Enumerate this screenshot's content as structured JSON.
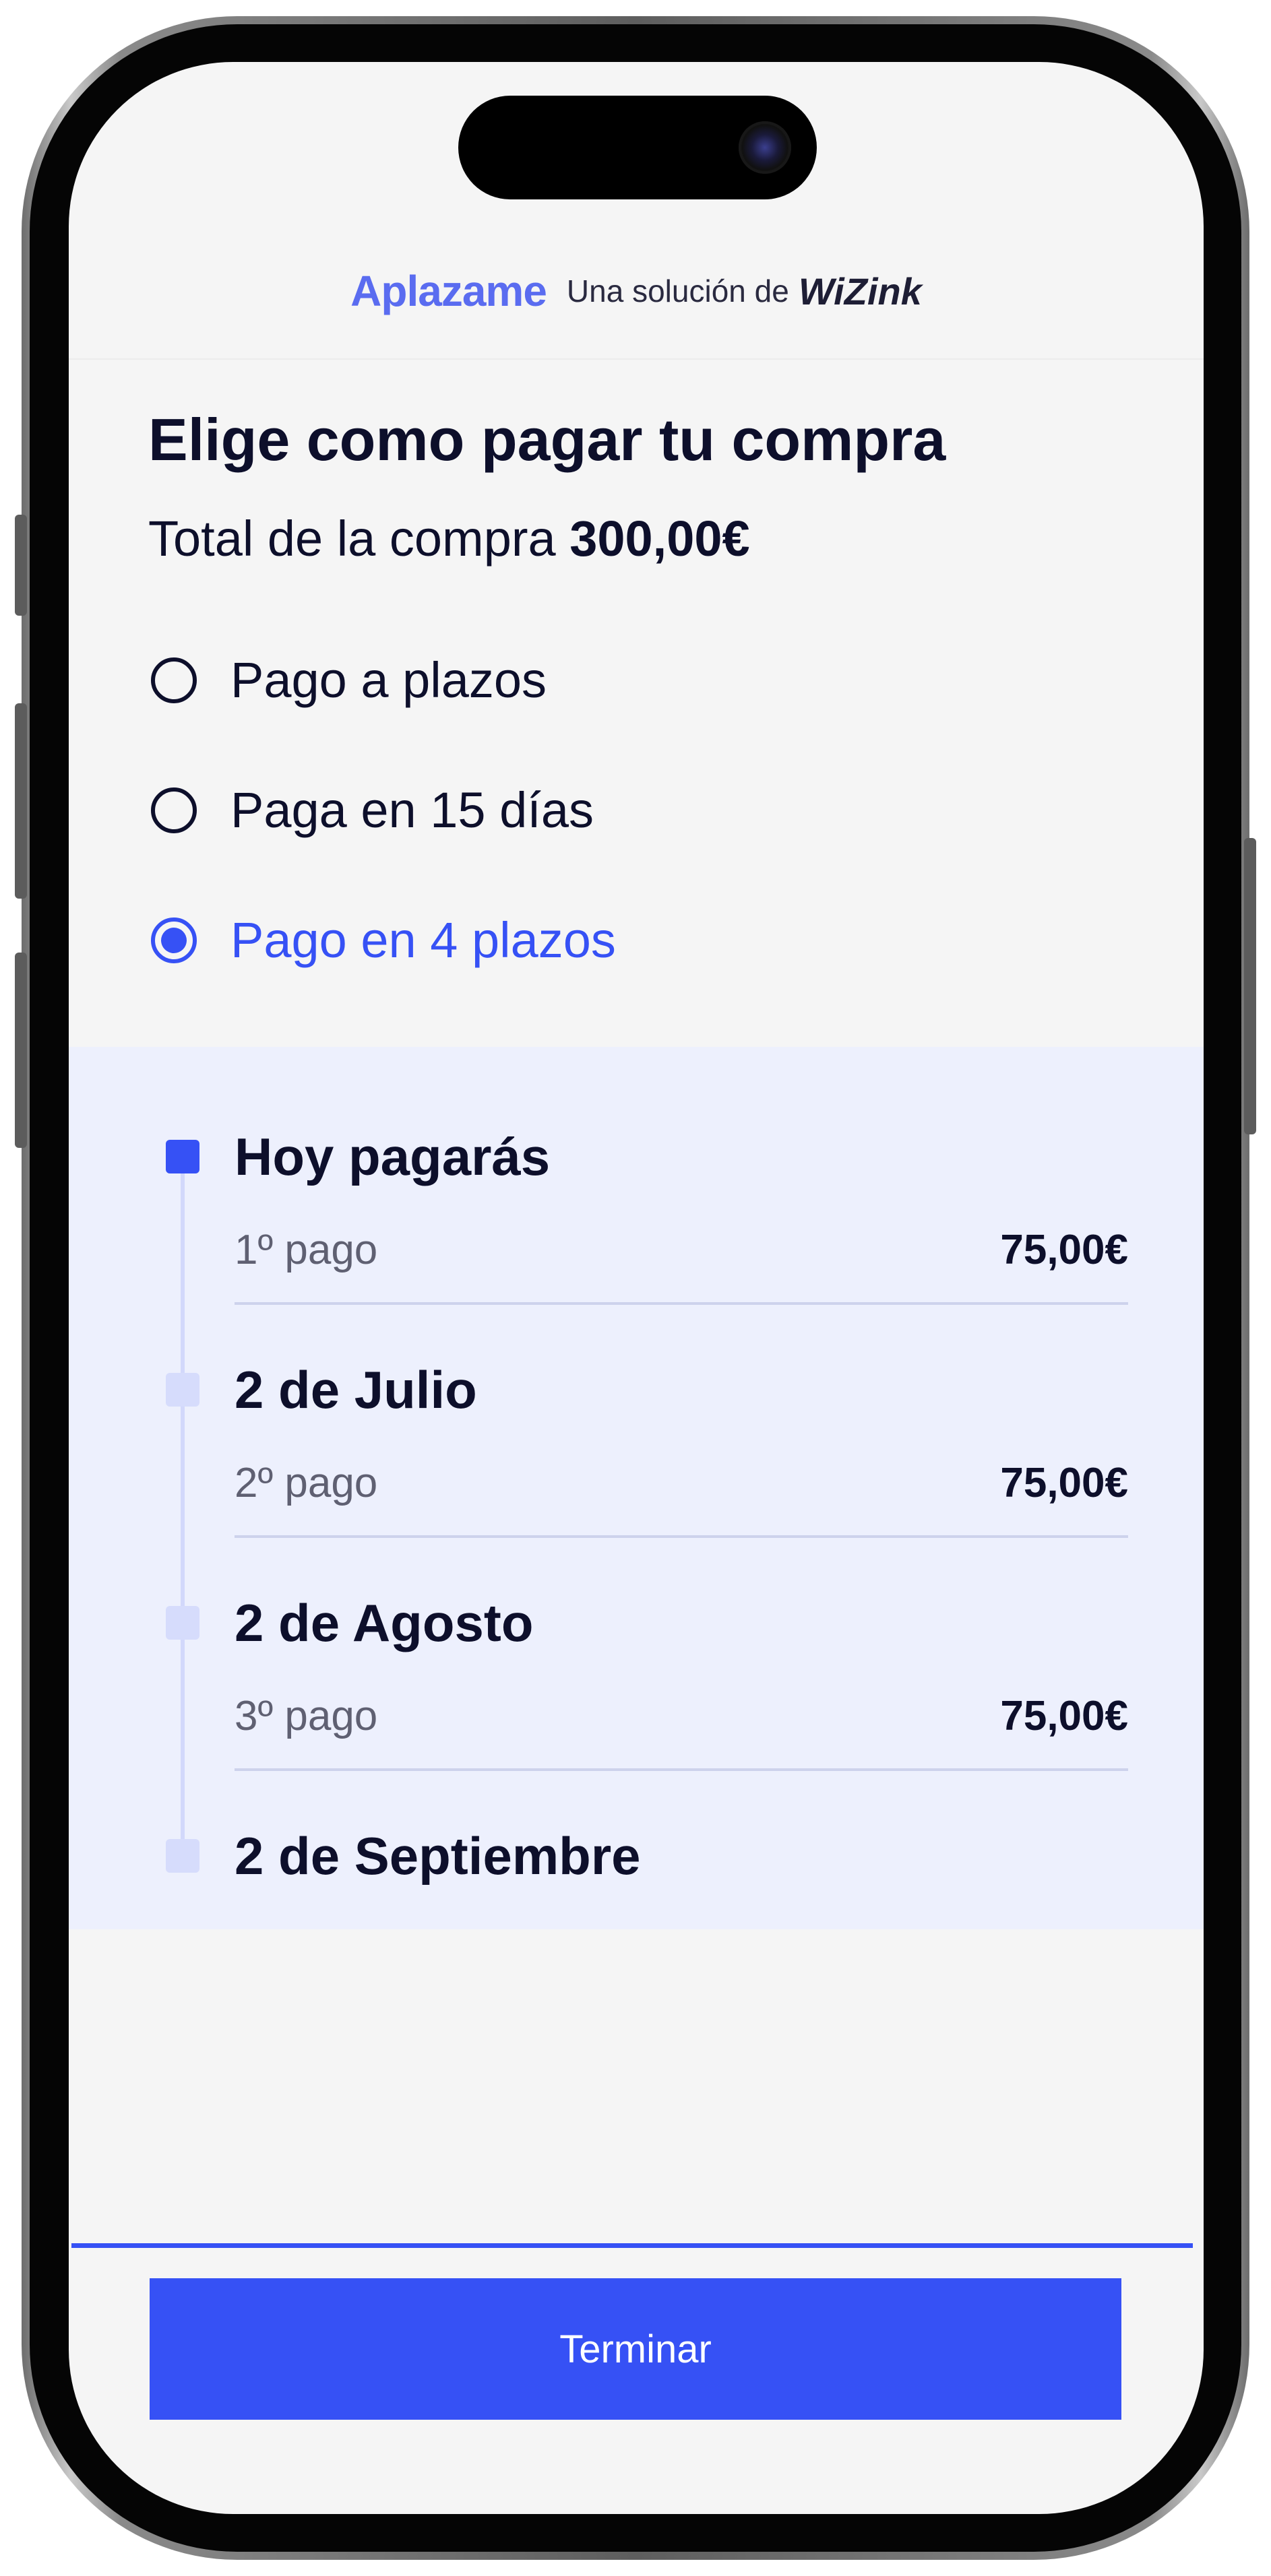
{
  "brand": {
    "logo": "Aplazame",
    "tagline": "Una solución de",
    "partner": "WiZink"
  },
  "checkout": {
    "title": "Elige como pagar tu compra",
    "total_label": "Total de la compra",
    "total_value": "300,00€"
  },
  "payment_options": [
    {
      "label": "Pago a plazos",
      "selected": false
    },
    {
      "label": "Paga en 15 días",
      "selected": false
    },
    {
      "label": "Pago en 4 plazos",
      "selected": true
    }
  ],
  "schedule": [
    {
      "title": "Hoy pagarás",
      "label": "1º pago",
      "amount": "75,00€",
      "current": true
    },
    {
      "title": "2 de Julio",
      "label": "2º pago",
      "amount": "75,00€",
      "current": false
    },
    {
      "title": "2 de Agosto",
      "label": "3º pago",
      "amount": "75,00€",
      "current": false
    },
    {
      "title": "2 de Septiembre",
      "current": false
    }
  ],
  "footer": {
    "button_label": "Terminar"
  },
  "colors": {
    "accent": "#3651f5",
    "text": "#0d0f2b",
    "plan_background": "#edf0fd"
  }
}
